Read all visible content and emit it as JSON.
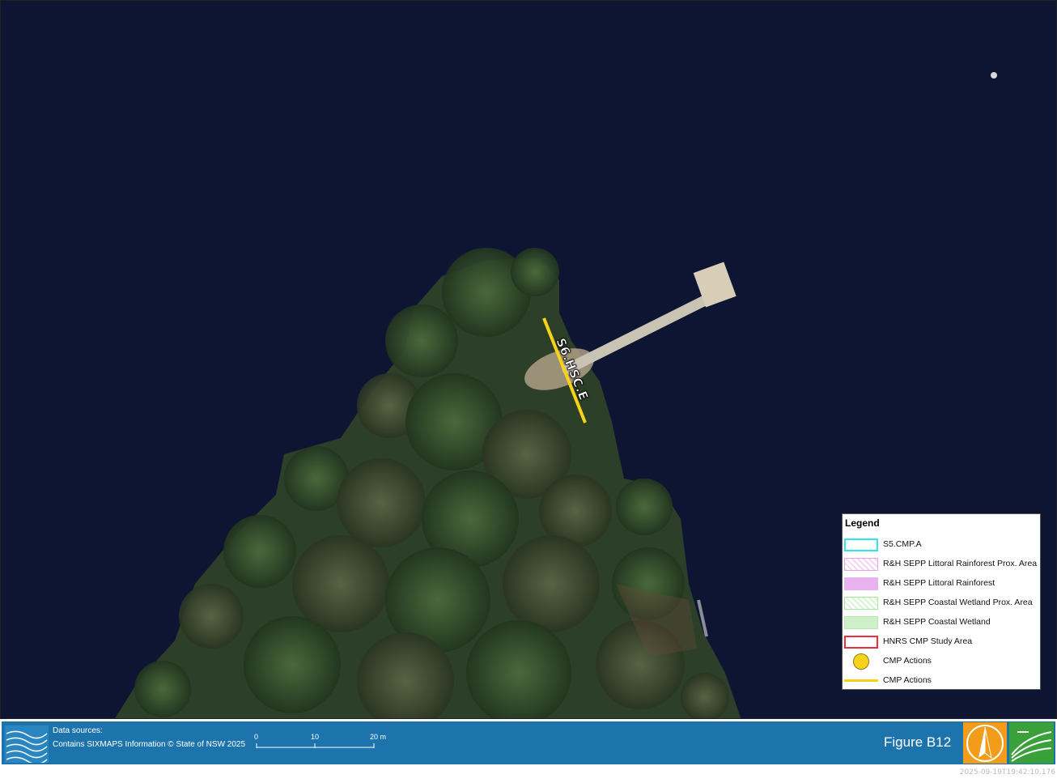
{
  "map": {
    "action_label": "S6.HSC.E",
    "colors": {
      "water": "#0c1330",
      "vegetation": "#3d5a32",
      "action_yellow": "#f6d31a",
      "jetty": "#c9c3b4"
    }
  },
  "legend": {
    "title": "Legend",
    "items": [
      {
        "label": "S5.CMP.A",
        "symbol": "box-outline",
        "color": "#2ee6ea"
      },
      {
        "label": "R&H SEPP Littoral Rainforest Prox. Area",
        "symbol": "hatch",
        "color": "#e6a4e6"
      },
      {
        "label": "R&H SEPP Littoral Rainforest",
        "symbol": "fill",
        "color": "#e9b3ef"
      },
      {
        "label": "R&H SEPP Coastal Wetland Prox. Area",
        "symbol": "hatch",
        "color": "#a6e6a0"
      },
      {
        "label": "R&H SEPP Coastal Wetland",
        "symbol": "fill",
        "color": "#cdf0c8"
      },
      {
        "label": "HNRS CMP Study Area",
        "symbol": "box-outline",
        "color": "#e8323a"
      },
      {
        "label": "CMP Actions",
        "symbol": "circle",
        "color": "#f6d31a"
      },
      {
        "label": "CMP Actions",
        "symbol": "line",
        "color": "#f6d31a"
      }
    ]
  },
  "footer": {
    "sources_heading": "Data sources:",
    "sources_text": "Contains SIXMAPS Information © State of NSW 2025",
    "scale": {
      "ticks": [
        "0",
        "10",
        "20 m"
      ]
    },
    "figure_label": "Figure B12",
    "bar_color": "#1d74ad"
  },
  "timestamp": "2025-09-19T19:42:10.176"
}
